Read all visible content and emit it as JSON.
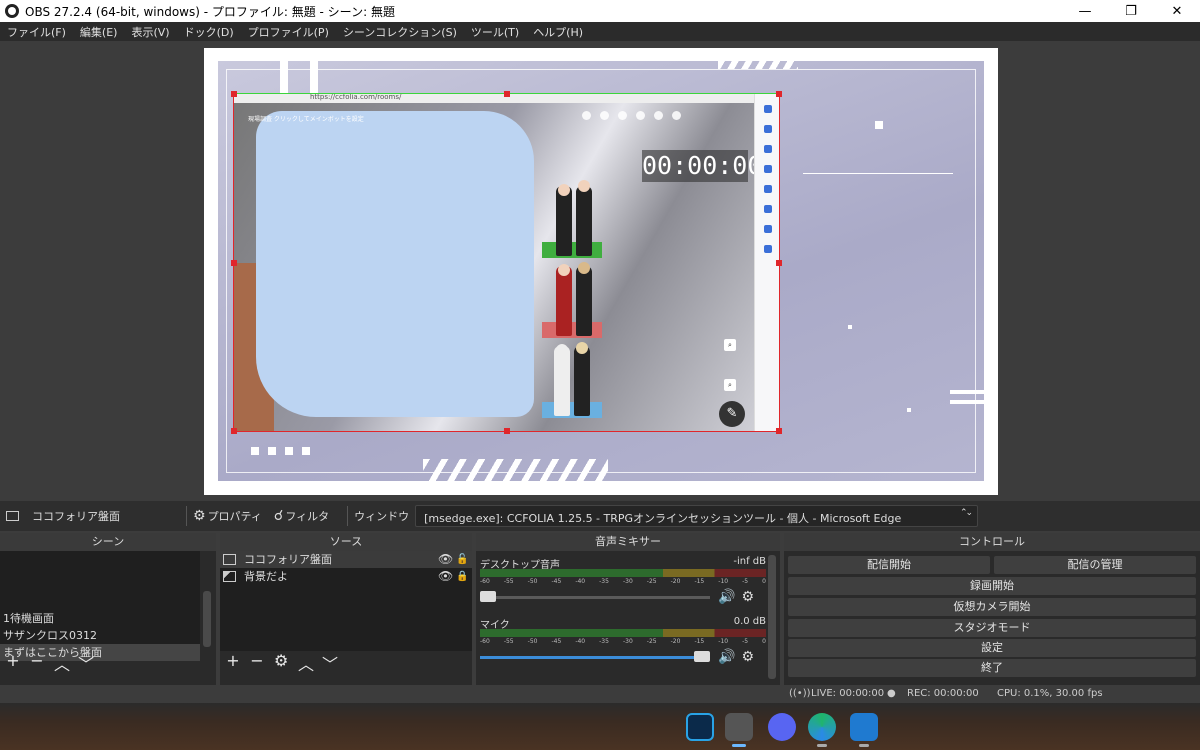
{
  "window": {
    "title": "OBS 27.2.4 (64-bit, windows) - プロファイル: 無題 - シーン: 無題",
    "minimize": "—",
    "maximize": "❐",
    "close": "✕"
  },
  "menu": [
    "ファイル(F)",
    "編集(E)",
    "表示(V)",
    "ドック(D)",
    "プロファイル(P)",
    "シーンコレクション(S)",
    "ツール(T)",
    "ヘルプ(H)"
  ],
  "preview": {
    "url": "https://ccfolia.com/rooms/",
    "room_title": "現場調査 クリックしてメインボットを設定",
    "timer": "00:00:00"
  },
  "source_toolbar": {
    "selected_source": "ココフォリア盤面",
    "properties": "プロパティ",
    "filters": "フィルタ",
    "window_label": "ウィンドウ",
    "window_value": "[msedge.exe]: CCFOLIA 1.25.5 - TRPGオンラインセッションツール - 個人 - Microsoft Edge"
  },
  "scenes": {
    "title": "シーン",
    "items": [
      "1待機画面",
      "サザンクロス0312",
      "まずはここから盤面"
    ],
    "selected_index": 2
  },
  "sources": {
    "title": "ソース",
    "items": [
      "ココフォリア盤面",
      "背景だよ"
    ]
  },
  "mixer": {
    "title": "音声ミキサー",
    "channels": [
      {
        "name": "デスクトップ音声",
        "level": "-inf dB",
        "fader": 0.0
      },
      {
        "name": "マイク",
        "level": "0.0 dB",
        "fader": 1.0
      }
    ],
    "scale": [
      "-60",
      "-55",
      "-50",
      "-45",
      "-40",
      "-35",
      "-30",
      "-25",
      "-20",
      "-15",
      "-10",
      "-5",
      "0"
    ]
  },
  "controls": {
    "title": "コントロール",
    "start_stream": "配信開始",
    "manage_stream": "配信の管理",
    "start_recording": "録画開始",
    "virtual_camera": "仮想カメラ開始",
    "studio_mode": "スタジオモード",
    "settings": "設定",
    "exit": "終了"
  },
  "status": {
    "live": "LIVE: 00:00:00",
    "rec": "REC: 00:00:00",
    "cpu": "CPU: 0.1%, 30.00 fps"
  }
}
